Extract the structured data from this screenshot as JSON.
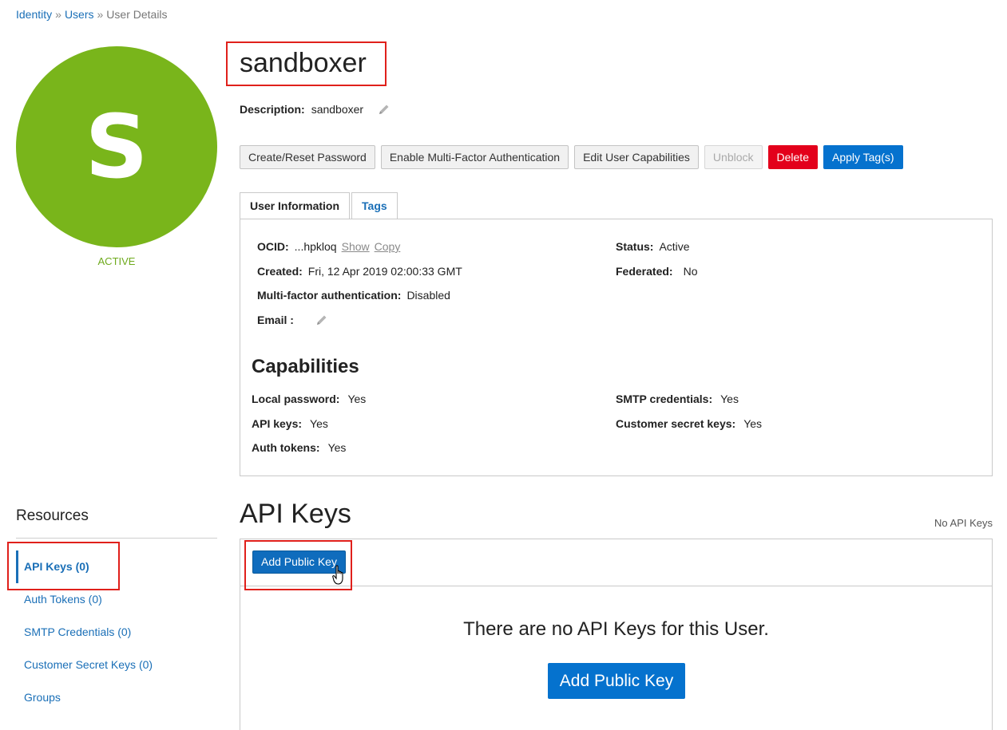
{
  "breadcrumb": {
    "items": [
      "Identity",
      "Users",
      "User Details"
    ],
    "separator": "»"
  },
  "user": {
    "avatar_letter": "S",
    "avatar_color": "#79b51b",
    "status_label": "ACTIVE",
    "name": "sandboxer",
    "description_label": "Description:",
    "description_value": "sandboxer"
  },
  "actions": {
    "create_reset_password": "Create/Reset Password",
    "enable_mfa": "Enable Multi-Factor Authentication",
    "edit_capabilities": "Edit User Capabilities",
    "unblock": "Unblock",
    "delete": "Delete",
    "apply_tags": "Apply Tag(s)"
  },
  "tabs": {
    "user_information": "User Information",
    "tags": "Tags"
  },
  "info": {
    "ocid_label": "OCID:",
    "ocid_value": "...hpkloq",
    "ocid_show": "Show",
    "ocid_copy": "Copy",
    "created_label": "Created:",
    "created_value": "Fri, 12 Apr 2019 02:00:33 GMT",
    "mfa_label": "Multi-factor authentication:",
    "mfa_value": "Disabled",
    "email_label": "Email :",
    "status_label": "Status:",
    "status_value": "Active",
    "federated_label": "Federated:",
    "federated_value": "No"
  },
  "capabilities": {
    "title": "Capabilities",
    "local_password_label": "Local password:",
    "local_password_value": "Yes",
    "api_keys_label": "API keys:",
    "api_keys_value": "Yes",
    "auth_tokens_label": "Auth tokens:",
    "auth_tokens_value": "Yes",
    "smtp_label": "SMTP credentials:",
    "smtp_value": "Yes",
    "customer_secret_label": "Customer secret keys:",
    "customer_secret_value": "Yes"
  },
  "resources": {
    "title": "Resources",
    "items": [
      "API Keys (0)",
      "Auth Tokens (0)",
      "SMTP Credentials (0)",
      "Customer Secret Keys (0)",
      "Groups"
    ]
  },
  "api_keys": {
    "title": "API Keys",
    "count_text": "No API Keys",
    "add_button": "Add Public Key",
    "empty_message": "There are no API Keys for this User.",
    "add_button_large": "Add Public Key"
  },
  "colors": {
    "accent": "#0572ce",
    "danger": "#e3001b",
    "active_green": "#6eaa1c",
    "highlight_red": "#e0201b"
  }
}
